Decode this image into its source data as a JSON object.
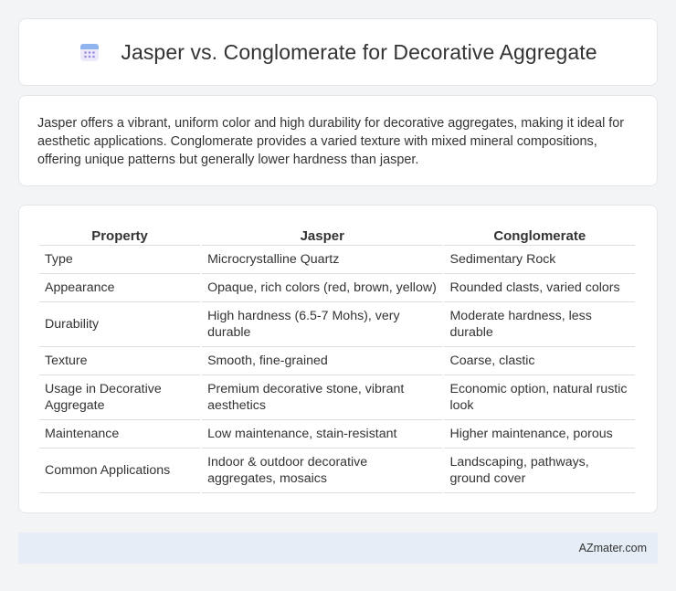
{
  "header": {
    "icon": "calendar-icon",
    "title": "Jasper vs. Conglomerate for Decorative Aggregate"
  },
  "intro": {
    "text": "Jasper offers a vibrant, uniform color and high durability for decorative aggregates, making it ideal for aesthetic applications. Conglomerate provides a varied texture with mixed mineral compositions, offering unique patterns but generally lower hardness than jasper."
  },
  "table": {
    "headers": [
      "Property",
      "Jasper",
      "Conglomerate"
    ],
    "rows": [
      [
        "Type",
        "Microcrystalline Quartz",
        "Sedimentary Rock"
      ],
      [
        "Appearance",
        "Opaque, rich colors (red, brown, yellow)",
        "Rounded clasts, varied colors"
      ],
      [
        "Durability",
        "High hardness (6.5-7 Mohs), very durable",
        "Moderate hardness, less durable"
      ],
      [
        "Texture",
        "Smooth, fine-grained",
        "Coarse, clastic"
      ],
      [
        "Usage in Decorative Aggregate",
        "Premium decorative stone, vibrant aesthetics",
        "Economic option, natural rustic look"
      ],
      [
        "Maintenance",
        "Low maintenance, stain-resistant",
        "Higher maintenance, porous"
      ],
      [
        "Common Applications",
        "Indoor & outdoor decorative aggregates, mosaics",
        "Landscaping, pathways, ground cover"
      ]
    ]
  },
  "footer": {
    "brand": "AZmater.com"
  },
  "colors": {
    "page_background": "#f3f4f6",
    "card_background": "#ffffff",
    "footer_background": "#e6edf7",
    "icon_accent": "#8b7fd6"
  }
}
